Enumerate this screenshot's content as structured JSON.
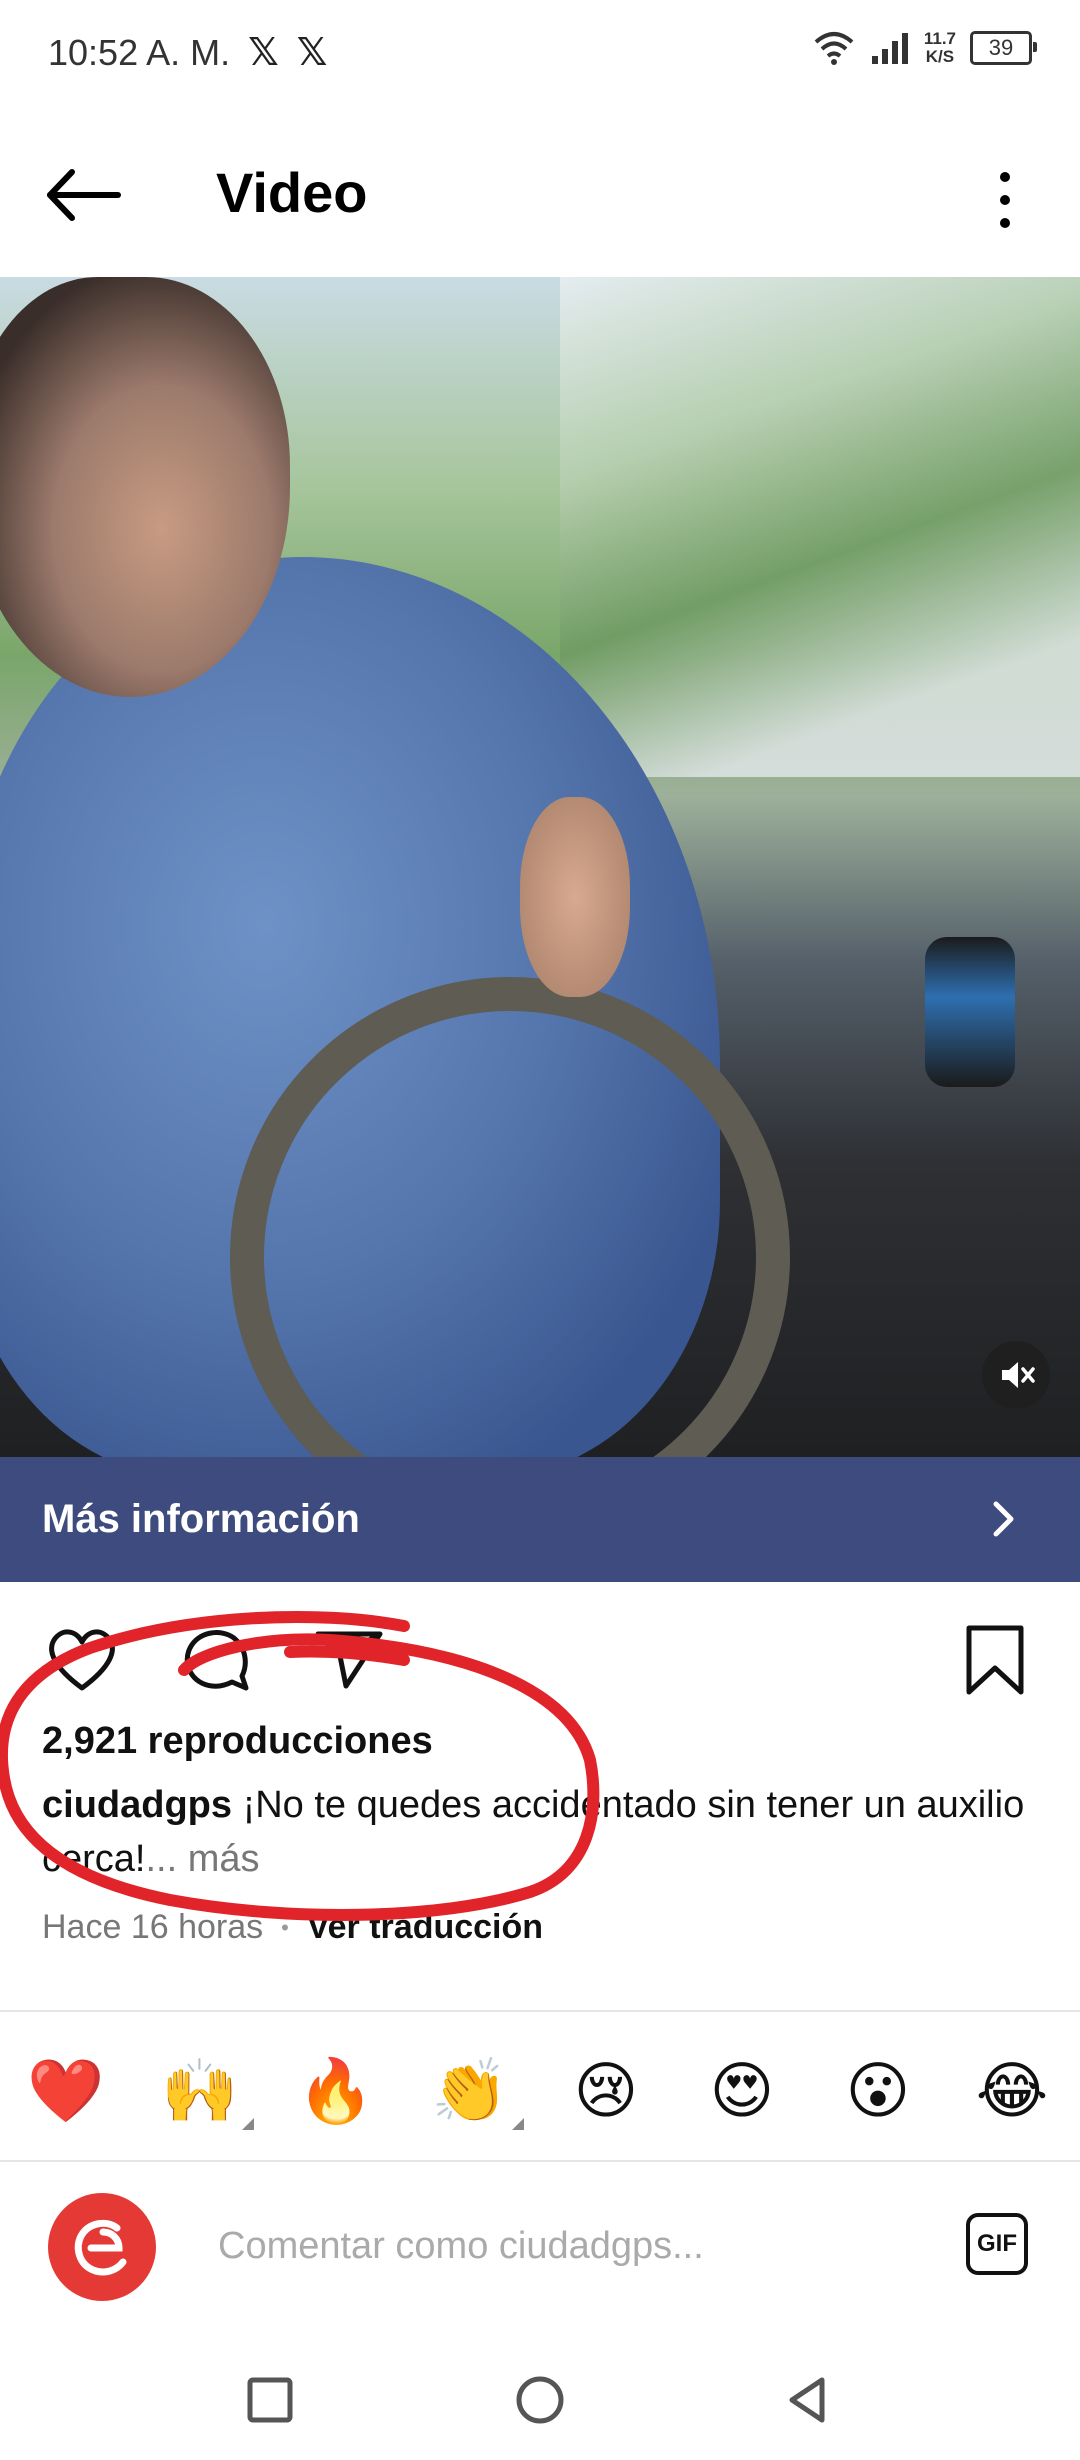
{
  "status_bar": {
    "time": "10:52 A. M.",
    "notifications": [
      "𝕏",
      "𝕏"
    ],
    "net_speed_value": "11.7",
    "net_speed_unit": "K/S",
    "battery": "39",
    "icons": [
      "wifi-icon",
      "signal-icon",
      "battery-icon"
    ]
  },
  "header": {
    "title": "Video",
    "back_icon": "arrow-left-icon",
    "more_icon": "vertical-dots-icon"
  },
  "video": {
    "muted": true,
    "mute_icon": "speaker-muted-icon"
  },
  "info_bar": {
    "label": "Más información",
    "color": "#3e4b7e"
  },
  "actions": {
    "icons": [
      "heart-icon",
      "comment-icon",
      "share-icon",
      "bookmark-icon"
    ]
  },
  "post": {
    "views": "2,921 reproducciones",
    "username": "ciudadgps",
    "caption": " ¡No te quedes accidentado sin tener un auxilio cerca!",
    "more": "... más",
    "time_ago": "Hace 16 horas",
    "separator": "•",
    "translate": "Ver traducción"
  },
  "annotation": {
    "color": "#e0242a"
  },
  "emoji_reactions": [
    "❤️",
    "🙌",
    "🔥",
    "👏",
    "😢",
    "😍",
    "😮",
    "😂"
  ],
  "comment": {
    "placeholder": "Comentar como ciudadgps...",
    "gif_label": "GIF",
    "avatar_color": "#e53935"
  },
  "system_nav": [
    "recent-apps-icon",
    "home-icon",
    "back-icon"
  ]
}
